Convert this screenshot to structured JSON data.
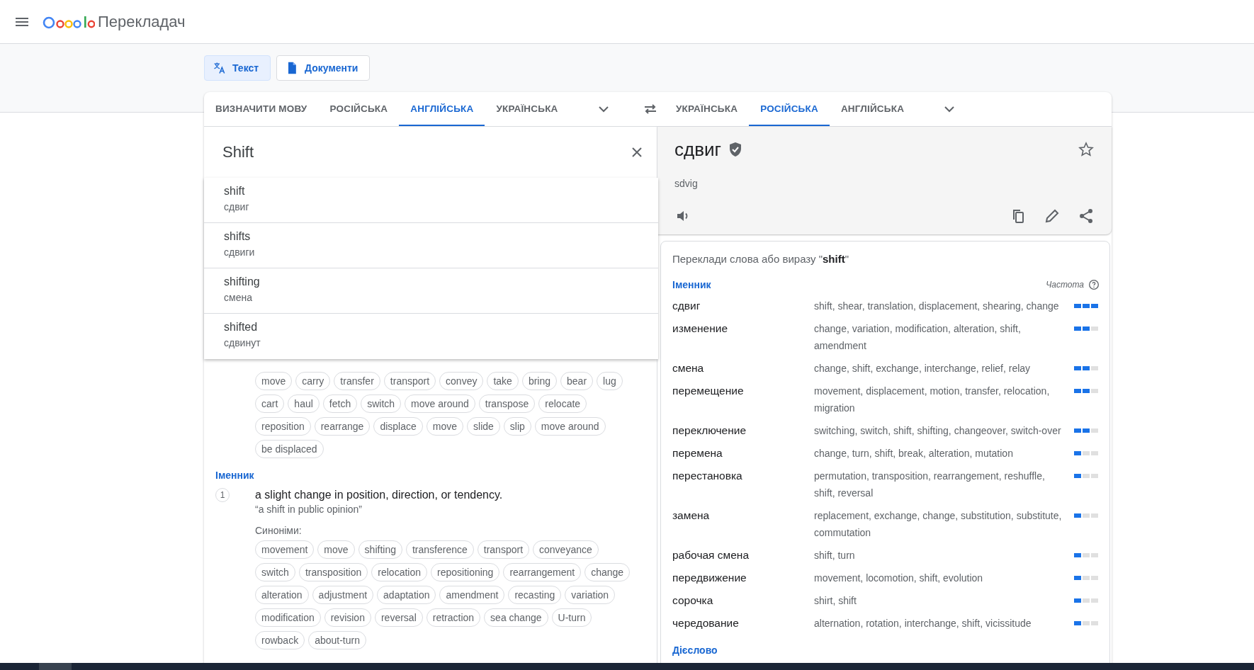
{
  "header": {
    "title": "Перекладач"
  },
  "modes": [
    {
      "label": "Текст",
      "kind": "text",
      "selected": true
    },
    {
      "label": "Документи",
      "kind": "document",
      "selected": false
    }
  ],
  "source_tabs": [
    {
      "label": "ВИЗНАЧИТИ МОВУ",
      "selected": false
    },
    {
      "label": "РОСІЙСЬКА",
      "selected": false
    },
    {
      "label": "АНГЛІЙСЬКА",
      "selected": true
    },
    {
      "label": "УКРАЇНСЬКА",
      "selected": false
    }
  ],
  "target_tabs": [
    {
      "label": "УКРАЇНСЬКА",
      "selected": false
    },
    {
      "label": "РОСІЙСЬКА",
      "selected": true
    },
    {
      "label": "АНГЛІЙСЬКА",
      "selected": false
    }
  ],
  "input": {
    "value": "Shift"
  },
  "suggestions": [
    {
      "word": "shift",
      "translation": "сдвиг"
    },
    {
      "word": "shifts",
      "translation": "сдвиги"
    },
    {
      "word": "shifting",
      "translation": "смена"
    },
    {
      "word": "shifted",
      "translation": "сдвинут"
    }
  ],
  "definitions": [
    {
      "synonyms": [
        "move",
        "carry",
        "transfer",
        "transport",
        "convey",
        "take",
        "bring",
        "bear",
        "lug",
        "cart",
        "haul",
        "fetch",
        "switch",
        "move around",
        "transpose",
        "relocate",
        "reposition",
        "rearrange",
        "displace",
        "move",
        "slide",
        "slip",
        "move around",
        "be displaced"
      ]
    },
    {
      "pos": "Іменник",
      "number": "1",
      "definition": "a slight change in position, direction, or tendency.",
      "example": "“a shift in public opinion”",
      "synonyms_label": "Синоніми:",
      "synonyms": [
        "movement",
        "move",
        "shifting",
        "transference",
        "transport",
        "conveyance",
        "switch",
        "transposition",
        "relocation",
        "repositioning",
        "rearrangement",
        "change",
        "alteration",
        "adjustment",
        "adaptation",
        "amendment",
        "recasting",
        "variation",
        "modification",
        "revision",
        "reversal",
        "retraction",
        "sea change",
        "U-turn",
        "rowback",
        "about-turn"
      ]
    }
  ],
  "result": {
    "translation": "сдвиг",
    "transliteration": "sdvig"
  },
  "translations": {
    "title": "Переклади слова або виразу \"**shift**\"",
    "frequency_label": "Частота",
    "groups": [
      {
        "pos": "Іменник",
        "rows": [
          {
            "word": "сдвиг",
            "synonyms": "shift, shear, translation, displacement, shearing, change",
            "level": 1
          },
          {
            "word": "изменение",
            "synonyms": "change, variation, modification, alteration, shift, amendment",
            "level": 0.67
          },
          {
            "word": "смена",
            "synonyms": "change, shift, exchange, interchange, relief, relay",
            "level": 0.67
          },
          {
            "word": "перемещение",
            "synonyms": "movement, displacement, motion, transfer, relocation, migration",
            "level": 0.67
          },
          {
            "word": "переключение",
            "synonyms": "switching, switch, shift, shifting, changeover, switch-over",
            "level": 0.67
          },
          {
            "word": "перемена",
            "synonyms": "change, turn, shift, break, alteration, mutation",
            "level": 0.33
          },
          {
            "word": "перестановка",
            "synonyms": "permutation, transposition, rearrangement, reshuffle, shift, reversal",
            "level": 0.33
          },
          {
            "word": "замена",
            "synonyms": "replacement, exchange, change, substitution, substitute, commutation",
            "level": 0.33
          },
          {
            "word": "рабочая смена",
            "synonyms": "shift, turn",
            "level": 0.33
          },
          {
            "word": "передвижение",
            "synonyms": "movement, locomotion, shift, evolution",
            "level": 0.33
          },
          {
            "word": "сорочка",
            "synonyms": "shirt, shift",
            "level": 0.33
          },
          {
            "word": "чередование",
            "synonyms": "alternation, rotation, interchange, shift, vicissitude",
            "level": 0.33
          }
        ]
      },
      {
        "pos": "Дієслово"
      }
    ]
  }
}
